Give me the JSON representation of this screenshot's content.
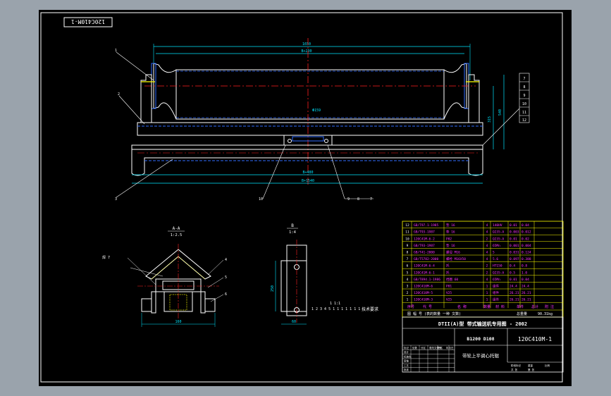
{
  "drawing": {
    "number_stamp": "120C410M-1",
    "colors": {
      "background": "#000000",
      "frame": "#ffffff",
      "outline": "#ffffff",
      "centerline": "#ff2020",
      "dimension": "#00e5ff",
      "hidden": "#2f6bff",
      "bom": "#ffff00",
      "bom_text": "#ff33ff",
      "part_fill": "#ffff00"
    },
    "main_view": {
      "balloons_left": [
        "1",
        "2",
        "3"
      ],
      "balloons_right": [
        "7",
        "8",
        "9",
        "10",
        "11",
        "12"
      ],
      "balloons_bottom": [
        "10",
        "9",
        "8",
        "7"
      ],
      "dim_top_outer": "1650",
      "dim_top_inner": "B+230",
      "dim_bottom_outer": "B+1540",
      "dim_bottom_inner": "B+480",
      "dim_center": "Φ159",
      "dim_right_1": "540",
      "dim_right_2": "315"
    },
    "section_aa": {
      "title": "A-A",
      "scale": "1:2.5",
      "callouts": [
        "4",
        "5",
        "6"
      ],
      "left_note": "焊 7",
      "bottom_dim": "160"
    },
    "section_b": {
      "title": "B",
      "scale": "1:4",
      "dims": [
        "60",
        "250"
      ]
    },
    "tech_note": {
      "label": "技术要求",
      "line1": "1 1:1",
      "line2": "1 2 3 4 5 1 1 1 1 1 1 1"
    },
    "bom_rows": [
      {
        "no": "12",
        "code": "GB/T97.1-1985",
        "name": "垫 16",
        "qty": "4",
        "mat": "140HV",
        "unit": "0.01",
        "total": "0.04"
      },
      {
        "no": "11",
        "code": "GB/T93-1987",
        "name": "垫 16",
        "qty": "4",
        "mat": "Q235-A",
        "unit": "0.003",
        "total": "0.012"
      },
      {
        "no": "10",
        "code": "120C41M-6-2",
        "name": "P02",
        "qty": "2",
        "mat": "Q235-A",
        "unit": "0.01",
        "total": "0.02"
      },
      {
        "no": "9",
        "code": "GB/T93-1987",
        "name": "垫 16",
        "qty": "4",
        "mat": "65Mn",
        "unit": "0.001",
        "total": "0.004"
      },
      {
        "no": "8",
        "code": "GB/T41-2000",
        "name": "螺母 M16",
        "qty": "4",
        "mat": "5",
        "unit": "0.031",
        "total": "0.124"
      },
      {
        "no": "7",
        "code": "GB/T5782-2000",
        "name": "螺栓 M16X50",
        "qty": "4",
        "mat": "5.6",
        "unit": "0.097",
        "total": "0.388"
      },
      {
        "no": "6",
        "code": "120C41M-6-4",
        "name": "托",
        "qty": "2",
        "mat": "HT150",
        "unit": "0.4",
        "total": "0.8"
      },
      {
        "no": "5",
        "code": "120C41M-6-1",
        "name": "托",
        "qty": "2",
        "mat": "Q235-A",
        "unit": "0.5",
        "total": "1.0"
      },
      {
        "no": "4",
        "code": "GB/T894.1-1986",
        "name": "挡圈 60",
        "qty": "4",
        "mat": "65Mn",
        "unit": "0.01",
        "total": "0.04"
      },
      {
        "no": "3",
        "code": "120C410M-6",
        "name": "P01",
        "qty": "1",
        "mat": "组件",
        "unit": "24.4",
        "total": "24.4"
      },
      {
        "no": "2",
        "code": "120C410M-5",
        "name": "V25",
        "qty": "1",
        "mat": "组件",
        "unit": "26.21",
        "total": "26.21"
      },
      {
        "no": "1",
        "code": "120C410M-3",
        "name": "V25",
        "qty": "1",
        "mat": "组件",
        "unit": "26.21",
        "total": "26.21"
      }
    ],
    "bom_header": {
      "no": "序号",
      "code": "代 号",
      "name": "名 称",
      "qty": "数量",
      "mat": "材 料",
      "unit": "单件",
      "total": "总计",
      "remark": "附 注"
    },
    "bom_footer": {
      "left": "图 幅 号 (表的数量 一种 文数)",
      "weight_label": "总重量",
      "weight": "90.31kg"
    },
    "title_block": {
      "series_title": "DTII(A)型  带式输送机专用图 - 2002",
      "spec": "B1200 D108",
      "drawing_no": "120C410M-1",
      "part_name": "带轮上平调心托辊",
      "grid_labels": [
        "标记",
        "处数",
        "分区",
        "更改文件号",
        "签名",
        "年月日",
        "设计",
        "标准化",
        "审核",
        "工艺",
        "批准",
        "阶段标记",
        "重量",
        "比例",
        "共 张",
        "第 张"
      ]
    }
  }
}
